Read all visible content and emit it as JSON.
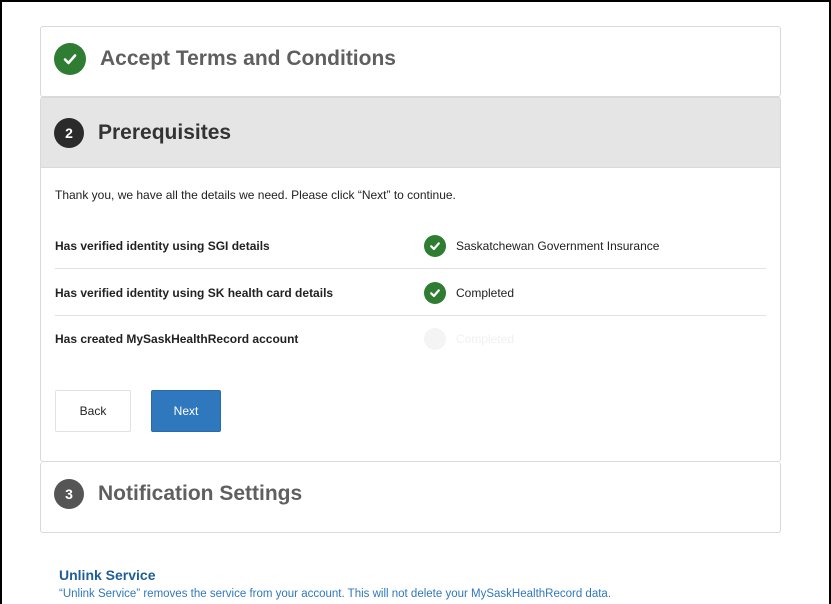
{
  "steps": [
    {
      "title": "Accept Terms and Conditions",
      "state": "completed"
    },
    {
      "number": "2",
      "title": "Prerequisites",
      "state": "active"
    },
    {
      "number": "3",
      "title": "Notification Settings",
      "state": "pending"
    }
  ],
  "prerequisites": {
    "intro": "Thank you, we have all the details we need. Please click “Next” to continue.",
    "rows": [
      {
        "label": "Has verified identity using SGI details",
        "value": "Saskatchewan Government Insurance"
      },
      {
        "label": "Has verified identity using SK health card details",
        "value": "Completed"
      },
      {
        "label": "Has created MySaskHealthRecord account",
        "value": "Completed"
      }
    ],
    "back_label": "Back",
    "next_label": "Next"
  },
  "unlink": {
    "title": "Unlink Service",
    "description": "“Unlink Service” removes the service from your account. This will not delete your MySaskHealthRecord data."
  },
  "icons": {
    "step_complete": "check-circle-icon",
    "row_complete": "check-circle-icon"
  },
  "colors": {
    "success": "#2e7d32",
    "primary": "#2f78bd",
    "link": "#1f5e99",
    "active_step_bg": "#e5e5e5"
  }
}
